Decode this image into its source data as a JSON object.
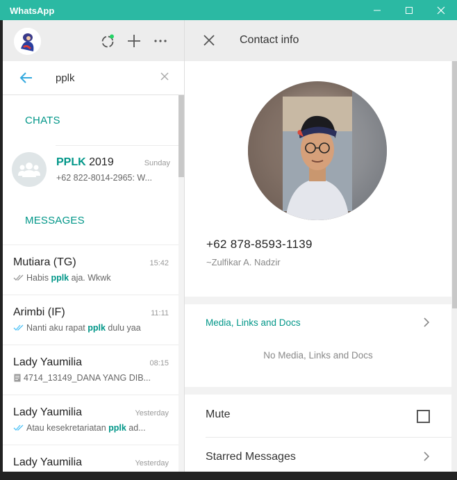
{
  "window": {
    "title": "WhatsApp"
  },
  "sidebar": {
    "search": {
      "value": "pplk"
    },
    "chats_section": "CHATS",
    "messages_section": "MESSAGES",
    "chats": [
      {
        "name_highlight": "PPLK",
        "name_rest": " 2019",
        "time": "Sunday",
        "preview": "+62 822-8014-2965: W..."
      }
    ],
    "messages": [
      {
        "name": "Mutiara (TG)",
        "time": "15:42",
        "prefix": "Habis ",
        "highlight": "pplk",
        "suffix": " aja. Wkwk",
        "status": "read-grey"
      },
      {
        "name": "Arimbi (IF)",
        "time": "11:11",
        "prefix": "Nanti aku rapat ",
        "highlight": "pplk",
        "suffix": " dulu yaa",
        "status": "read-blue"
      },
      {
        "name": "Lady Yaumilia",
        "time": "08:15",
        "prefix": "4714_13149_DANA YANG DIB...",
        "highlight": "",
        "suffix": "",
        "status": "document"
      },
      {
        "name": "Lady Yaumilia",
        "time": "Yesterday",
        "prefix": "Atau kesekretariatan ",
        "highlight": "pplk",
        "suffix": " ad...",
        "status": "read-blue"
      },
      {
        "name": "Lady Yaumilia",
        "time": "Yesterday",
        "prefix": "",
        "highlight": "",
        "suffix": "",
        "status": ""
      }
    ]
  },
  "contact_info": {
    "title": "Contact info",
    "phone": "+62 878-8593-1139",
    "pushname": "~Zulfikar A. Nadzir",
    "media_title": "Media, Links and Docs",
    "media_empty": "No Media, Links and Docs",
    "mute_label": "Mute",
    "mute_checked": false,
    "starred_label": "Starred Messages"
  },
  "colors": {
    "titlebar": "#2bb9a3",
    "accent": "#009688",
    "read_tick": "#4fc3f7"
  },
  "icons": [
    "status-icon",
    "new-chat-icon",
    "menu-icon",
    "back-arrow-icon",
    "clear-icon",
    "close-icon",
    "chevron-right-icon",
    "group-icon",
    "double-tick-icon",
    "document-icon"
  ]
}
